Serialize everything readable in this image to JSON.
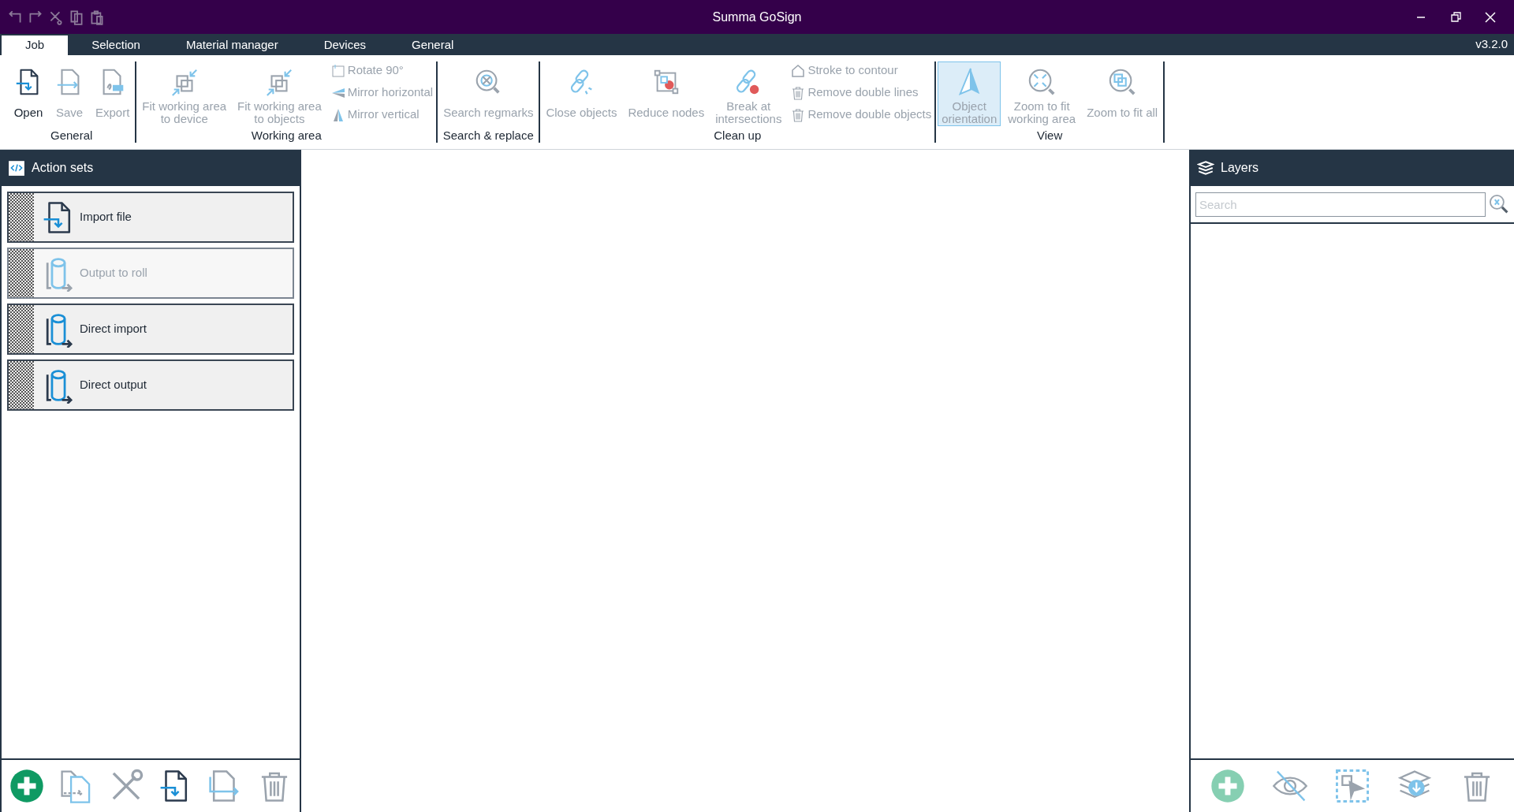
{
  "window": {
    "title": "Summa GoSign"
  },
  "tabs": [
    {
      "label": "Job",
      "selected": true
    },
    {
      "label": "Selection",
      "selected": false
    },
    {
      "label": "Material manager",
      "selected": false
    },
    {
      "label": "Devices",
      "selected": false
    },
    {
      "label": "General",
      "selected": false
    }
  ],
  "version": "v3.2.0",
  "ribbon": [
    {
      "label": "General",
      "items": [
        {
          "kind": "large",
          "label": "Open",
          "disabled": false,
          "selected": false
        },
        {
          "kind": "large",
          "label": "Save",
          "disabled": true,
          "selected": false
        },
        {
          "kind": "large",
          "label": "Export",
          "disabled": true,
          "selected": false
        }
      ]
    },
    {
      "label": "Working area",
      "items": [
        {
          "kind": "large",
          "label": "Fit working area\nto device",
          "disabled": true,
          "selected": false
        },
        {
          "kind": "large",
          "label": "Fit working area\nto objects",
          "disabled": true,
          "selected": false
        },
        {
          "kind": "small",
          "label": "Rotate 90°",
          "disabled": true,
          "selected": false
        },
        {
          "kind": "small",
          "label": "Mirror horizontal",
          "disabled": true,
          "selected": false
        },
        {
          "kind": "small",
          "label": "Mirror vertical",
          "disabled": true,
          "selected": false
        }
      ]
    },
    {
      "label": "Search & replace",
      "items": [
        {
          "kind": "large",
          "label": "Search regmarks",
          "disabled": true,
          "selected": false
        }
      ]
    },
    {
      "label": "Clean up",
      "items": [
        {
          "kind": "large",
          "label": "Close objects",
          "disabled": true,
          "selected": false
        },
        {
          "kind": "large",
          "label": "Reduce nodes",
          "disabled": true,
          "selected": false
        },
        {
          "kind": "large",
          "label": "Break at\nintersections",
          "disabled": true,
          "selected": false
        },
        {
          "kind": "small",
          "label": "Stroke to contour",
          "disabled": true,
          "selected": false
        },
        {
          "kind": "small",
          "label": "Remove double lines",
          "disabled": true,
          "selected": false
        },
        {
          "kind": "small",
          "label": "Remove double objects",
          "disabled": true,
          "selected": false
        }
      ]
    },
    {
      "label": "View",
      "items": [
        {
          "kind": "large",
          "label": "Object\norientation",
          "disabled": true,
          "selected": true
        },
        {
          "kind": "large",
          "label": "Zoom to fit\nworking area",
          "disabled": true,
          "selected": false
        },
        {
          "kind": "large",
          "label": "Zoom to fit all",
          "disabled": true,
          "selected": false
        }
      ]
    }
  ],
  "action_sets": {
    "title": "Action sets",
    "items": [
      {
        "label": "Import file",
        "disabled": false
      },
      {
        "label": "Output to roll",
        "disabled": true
      },
      {
        "label": "Direct import",
        "disabled": false
      },
      {
        "label": "Direct output",
        "disabled": false
      }
    ],
    "toolbar": [
      {
        "disabled": false
      },
      {
        "disabled": true
      },
      {
        "disabled": true
      },
      {
        "disabled": false
      },
      {
        "disabled": true
      },
      {
        "disabled": true
      }
    ]
  },
  "layers": {
    "title": "Layers",
    "search": {
      "placeholder": "Search"
    },
    "toolbar": [
      {
        "disabled": true
      },
      {
        "disabled": true
      },
      {
        "disabled": true
      },
      {
        "disabled": true
      },
      {
        "disabled": true
      }
    ]
  }
}
